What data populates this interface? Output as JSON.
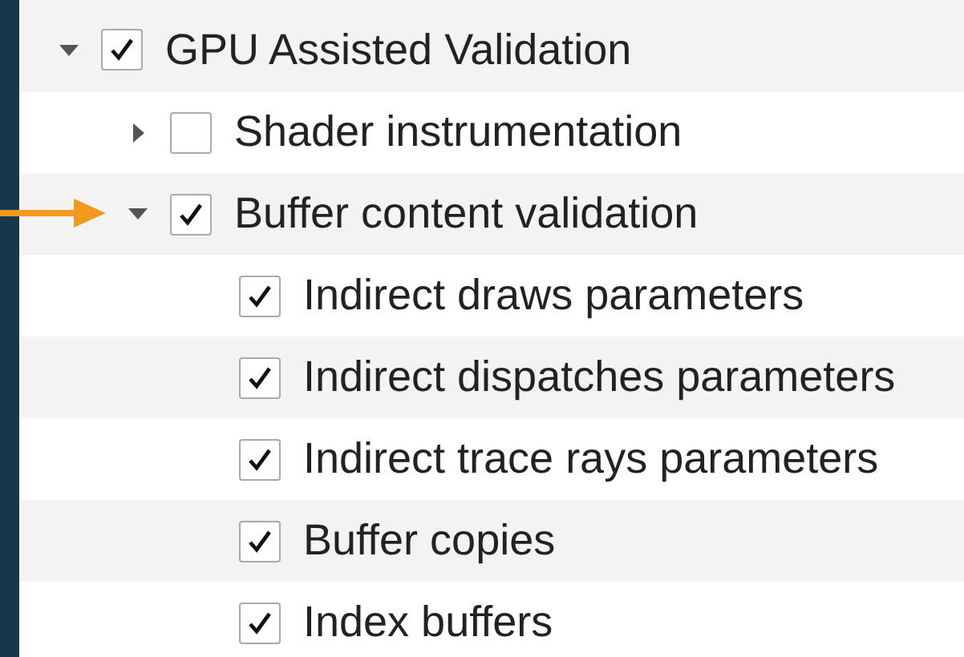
{
  "tree": [
    {
      "label": "GPU Assisted Validation",
      "checked": true,
      "expanded": true,
      "marked": false,
      "children": [
        {
          "label": "Shader instrumentation",
          "checked": false,
          "expanded": false,
          "marked": false
        },
        {
          "label": "Buffer content validation",
          "checked": true,
          "expanded": true,
          "marked": true,
          "children": [
            {
              "label": "Indirect draws parameters",
              "checked": true
            },
            {
              "label": "Indirect dispatches parameters",
              "checked": true
            },
            {
              "label": "Indirect trace rays parameters",
              "checked": true
            },
            {
              "label": "Buffer copies",
              "checked": true
            },
            {
              "label": "Index buffers",
              "checked": true
            }
          ]
        }
      ]
    }
  ]
}
